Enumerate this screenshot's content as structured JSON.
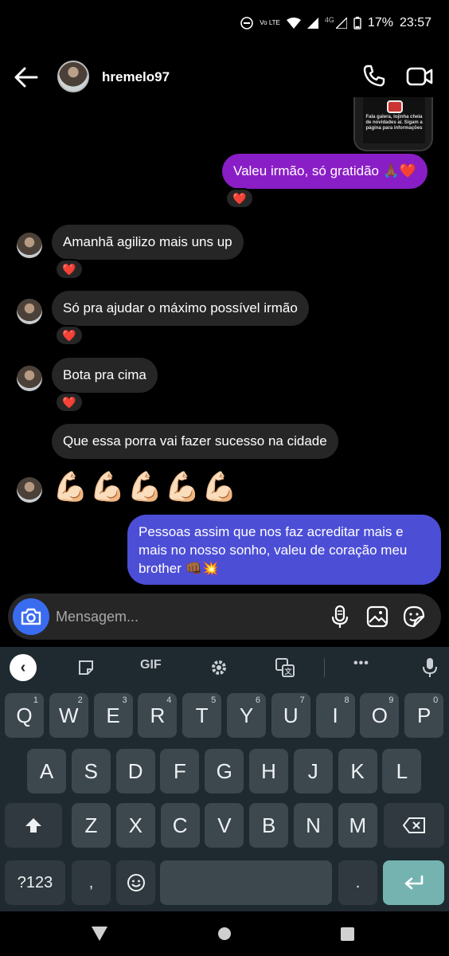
{
  "status_bar": {
    "battery": "17%",
    "time": "23:57",
    "lte_label": "Vo LTE",
    "network": "4G"
  },
  "header": {
    "username": "hremelo97"
  },
  "shared_post": {
    "text": "Fala galera, lojinha cheia de novidades aí. Sigam a página para informações"
  },
  "messages": [
    {
      "text": "Valeu irmão, só gratidão 🙏🏾❤️",
      "reaction": "❤️"
    },
    {
      "text": "Amanhã agilizo mais uns up",
      "reaction": "❤️"
    },
    {
      "text": "Só pra ajudar o máximo possível irmão",
      "reaction": "❤️"
    },
    {
      "text": "Bota pra cima",
      "reaction": "❤️"
    },
    {
      "text": "Que essa porra vai fazer sucesso na cidade"
    },
    {
      "text": "💪🏻💪🏻💪🏻💪🏻💪🏻"
    },
    {
      "text": "Pessoas assim que nos faz acreditar mais e mais no nosso sonho, valeu de coração meu brother 👊🏾💥"
    }
  ],
  "composer": {
    "placeholder": "Mensagem..."
  },
  "keyboard": {
    "toolbar": {
      "gif": "GIF",
      "more": "•••"
    },
    "row1": [
      {
        "k": "Q",
        "n": "1"
      },
      {
        "k": "W",
        "n": "2"
      },
      {
        "k": "E",
        "n": "3"
      },
      {
        "k": "R",
        "n": "4"
      },
      {
        "k": "T",
        "n": "5"
      },
      {
        "k": "Y",
        "n": "6"
      },
      {
        "k": "U",
        "n": "7"
      },
      {
        "k": "I",
        "n": "8"
      },
      {
        "k": "O",
        "n": "9"
      },
      {
        "k": "P",
        "n": "0"
      }
    ],
    "row2": [
      "A",
      "S",
      "D",
      "F",
      "G",
      "H",
      "J",
      "K",
      "L"
    ],
    "row3": [
      "Z",
      "X",
      "C",
      "V",
      "B",
      "N",
      "M"
    ],
    "symbols": "?123",
    "comma": ",",
    "period": "."
  },
  "icons": [
    "back-arrow-icon",
    "phone-icon",
    "video-call-icon",
    "camera-icon",
    "microphone-icon",
    "gallery-icon",
    "sticker-icon",
    "settings-icon",
    "translate-icon",
    "shift-icon",
    "backspace-icon",
    "enter-icon",
    "emoji-icon"
  ]
}
